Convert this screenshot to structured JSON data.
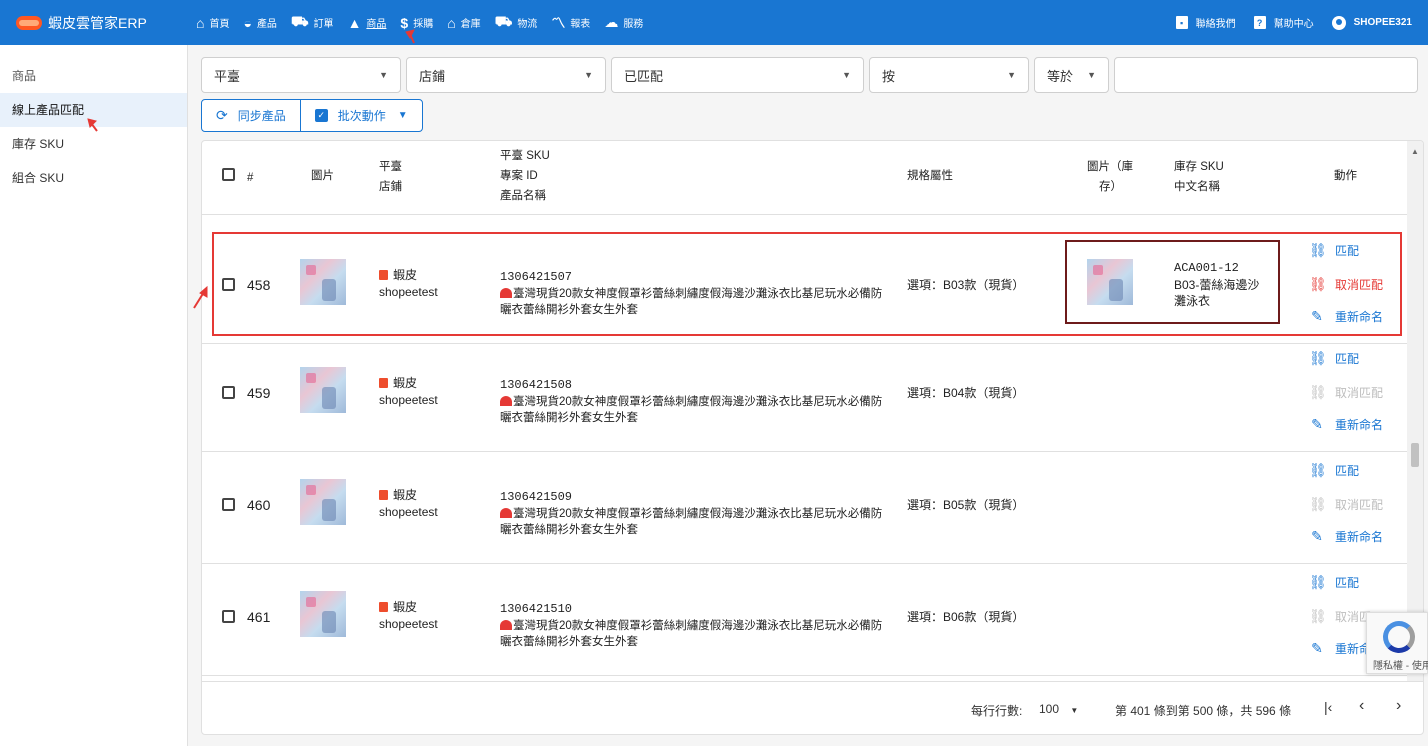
{
  "brand": {
    "title": "蝦皮雲管家ERP"
  },
  "nav": {
    "items": [
      {
        "label": "首頁",
        "icon": "home-icon",
        "glyph": "⌂"
      },
      {
        "label": "產品",
        "icon": "bag-icon",
        "glyph": "◒"
      },
      {
        "label": "訂單",
        "icon": "cart-icon",
        "glyph": "⛟"
      },
      {
        "label": "商品",
        "icon": "boxes-icon",
        "glyph": "▲"
      },
      {
        "label": "採購",
        "icon": "dollar-icon",
        "glyph": "$"
      },
      {
        "label": "倉庫",
        "icon": "warehouse-icon",
        "glyph": "⌂"
      },
      {
        "label": "物流",
        "icon": "truck-icon",
        "glyph": "⛟"
      },
      {
        "label": "報表",
        "icon": "chart-icon",
        "glyph": "〽"
      },
      {
        "label": "服務",
        "icon": "cloud-icon",
        "glyph": "☁"
      }
    ],
    "contact": "聯絡我們",
    "help": "幫助中心",
    "user": "SHOPEE321"
  },
  "sidebar": {
    "header": "商品",
    "items": [
      {
        "label": "線上產品匹配"
      },
      {
        "label": "庫存 SKU"
      },
      {
        "label": "組合 SKU"
      }
    ]
  },
  "filters": {
    "platform": "平臺",
    "shop": "店鋪",
    "match_status": "已匹配",
    "by": "按",
    "operator": "等於",
    "search_value": ""
  },
  "actions": {
    "sync": "同步產品",
    "batch": "批次動作"
  },
  "table": {
    "headers": {
      "index": "#",
      "image": "圖片",
      "platform": "平臺",
      "shop": "店鋪",
      "platform_sku": "平臺 SKU",
      "product_id": "專案 ID",
      "product_name": "產品名稱",
      "spec": "規格屬性",
      "stock_image_1": "圖片（庫",
      "stock_image_2": "存）",
      "stock_sku": "庫存 SKU",
      "cn_name": "中文名稱",
      "action": "動作"
    },
    "rows": [
      {
        "index": "458",
        "platform": "蝦皮",
        "shop": "shopeetest",
        "sku": "1306421507",
        "name": "臺灣現貨20款女神度假罩衫蕾絲刺繡度假海邊沙灘泳衣比基尼玩水必備防曬衣蕾絲開衫外套女生外套",
        "spec": "選項：B03款（現貨）",
        "stock_sku": "ACA001-12",
        "cn_name": "B03-蕾絲海邊沙灘泳衣",
        "match": "匹配",
        "unmatch": "取消匹配",
        "rename": "重新命名",
        "matched": true
      },
      {
        "index": "459",
        "platform": "蝦皮",
        "shop": "shopeetest",
        "sku": "1306421508",
        "name": "臺灣現貨20款女神度假罩衫蕾絲刺繡度假海邊沙灘泳衣比基尼玩水必備防曬衣蕾絲開衫外套女生外套",
        "spec": "選項：B04款（現貨）",
        "stock_sku": "",
        "cn_name": "",
        "match": "匹配",
        "unmatch": "取消匹配",
        "rename": "重新命名",
        "matched": false
      },
      {
        "index": "460",
        "platform": "蝦皮",
        "shop": "shopeetest",
        "sku": "1306421509",
        "name": "臺灣現貨20款女神度假罩衫蕾絲刺繡度假海邊沙灘泳衣比基尼玩水必備防曬衣蕾絲開衫外套女生外套",
        "spec": "選項：B05款（現貨）",
        "stock_sku": "",
        "cn_name": "",
        "match": "匹配",
        "unmatch": "取消匹配",
        "rename": "重新命名",
        "matched": false
      },
      {
        "index": "461",
        "platform": "蝦皮",
        "shop": "shopeetest",
        "sku": "1306421510",
        "name": "臺灣現貨20款女神度假罩衫蕾絲刺繡度假海邊沙灘泳衣比基尼玩水必備防曬衣蕾絲開衫外套女生外套",
        "spec": "選項：B06款（現貨）",
        "stock_sku": "",
        "cn_name": "",
        "match": "匹配",
        "unmatch": "取消匹",
        "rename": "重新命",
        "matched": false
      }
    ]
  },
  "pagination": {
    "rows_per_page_label": "每行行數:",
    "rows_per_page": "100",
    "range_text": "第 401 條到第 500 條，共 596 條"
  },
  "recaptcha": {
    "text": "隱私權 - 使用條款"
  },
  "colors": {
    "primary": "#1976d2",
    "danger": "#e53935",
    "highlight_dark": "#6d1b1b"
  }
}
